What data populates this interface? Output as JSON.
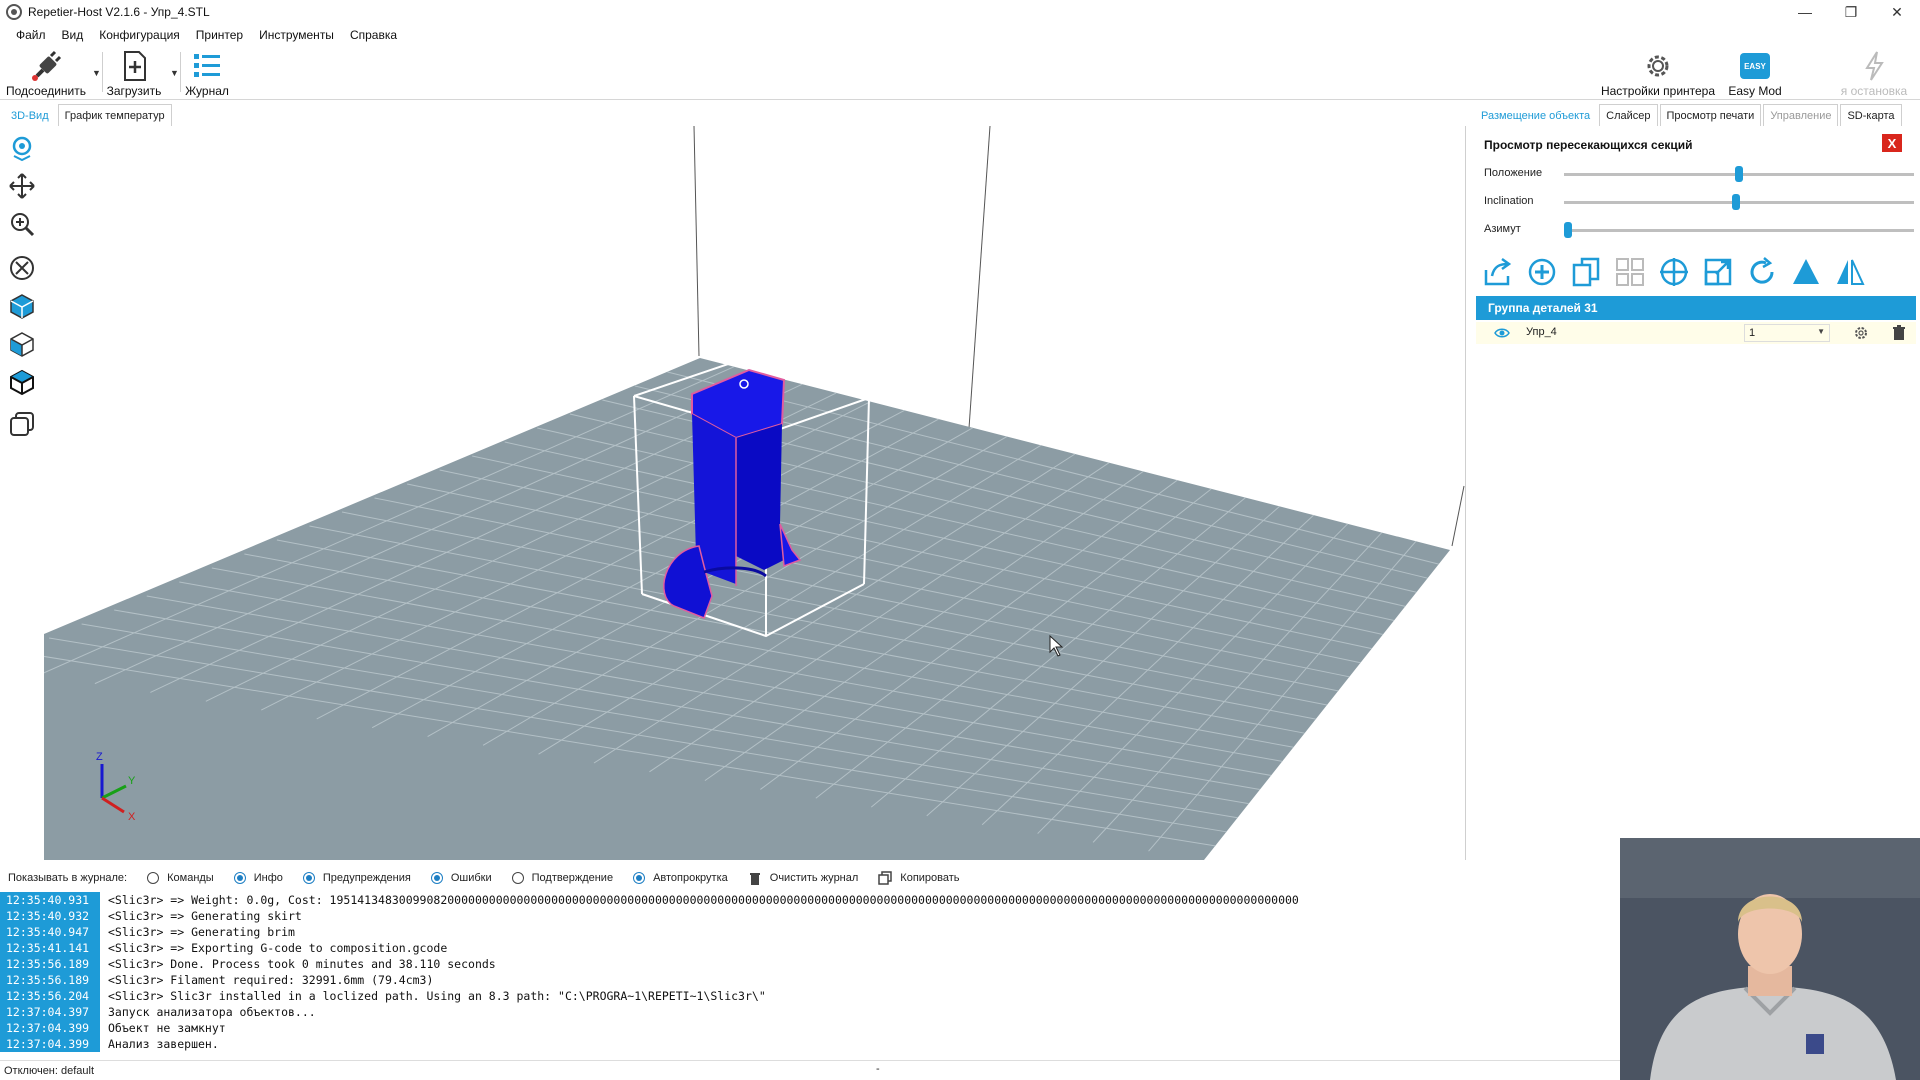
{
  "window": {
    "title": "Repetier-Host V2.1.6 - Упр_4.STL"
  },
  "menu": [
    "Файл",
    "Вид",
    "Конфигурация",
    "Принтер",
    "Инструменты",
    "Справка"
  ],
  "toolbar": {
    "connect": "Подсоединить",
    "load": "Загрузить",
    "log": "Журнал",
    "printer_settings": "Настройки принтера",
    "easy_mode": "Easy Mod",
    "easy_badge": "EASY",
    "estop": "я остановка"
  },
  "left_tabs": [
    "3D-Вид",
    "График температур"
  ],
  "right_tabs": [
    "Размещение объекта",
    "Слайсер",
    "Просмотр печати",
    "Управление",
    "SD-карта"
  ],
  "section_view": {
    "title": "Просмотр пересекающихся секций",
    "close": "X",
    "sliders": [
      {
        "label": "Положение",
        "value": 0.5
      },
      {
        "label": "Inclination",
        "value": 0.49
      },
      {
        "label": "Азимут",
        "value": 0.0
      }
    ]
  },
  "objects": {
    "group": "Группа деталей 31",
    "items": [
      {
        "name": "Упр_4",
        "count": "1"
      }
    ]
  },
  "axes": {
    "z": "Z",
    "y": "Y",
    "x": "X"
  },
  "log_filter": {
    "label": "Показывать в журнале:",
    "options": [
      {
        "label": "Команды",
        "on": false
      },
      {
        "label": "Инфо",
        "on": true
      },
      {
        "label": "Предупреждения",
        "on": true
      },
      {
        "label": "Ошибки",
        "on": true
      },
      {
        "label": "Подтверждение",
        "on": false
      },
      {
        "label": "Автопрокрутка",
        "on": true
      }
    ],
    "clear": "Очистить журнал",
    "copy": "Копировать"
  },
  "log": [
    {
      "time": "12:35:40.931",
      "msg": "<Slic3r> => Weight: 0.0g, Cost: 19514134830099082000000000000000000000000000000000000000000000000000000000000000000000000000000000000000000000000000000000000000000000000000"
    },
    {
      "time": "12:35:40.932",
      "msg": "<Slic3r> => Generating skirt"
    },
    {
      "time": "12:35:40.947",
      "msg": "<Slic3r> => Generating brim"
    },
    {
      "time": "12:35:41.141",
      "msg": "<Slic3r> => Exporting G-code to composition.gcode"
    },
    {
      "time": "12:35:56.189",
      "msg": "<Slic3r> Done. Process took 0 minutes and 38.110 seconds"
    },
    {
      "time": "12:35:56.189",
      "msg": "<Slic3r> Filament required: 32991.6mm (79.4cm3)"
    },
    {
      "time": "12:35:56.204",
      "msg": "<Slic3r> Slic3r installed in a loclized path. Using an 8.3 path: \"C:\\PROGRA~1\\REPETI~1\\Slic3r\\\""
    },
    {
      "time": "12:37:04.397",
      "msg": "Запуск анализатора объектов..."
    },
    {
      "time": "12:37:04.399",
      "msg": "Объект не замкнут"
    },
    {
      "time": "12:37:04.399",
      "msg": "Анализ завершен."
    }
  ],
  "status": {
    "text": "Отключен: default",
    "dash": "-"
  },
  "colors": {
    "accent": "#1e9bd7",
    "model": "#1010e0",
    "bed": "#8c9ca4",
    "close": "#d9261c"
  }
}
